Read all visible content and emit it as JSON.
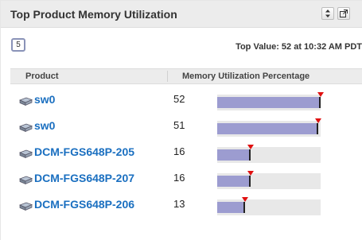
{
  "widget": {
    "title": "Top Product Memory Utilization",
    "count": "5",
    "top_value": "Top Value: 52 at 10:32 AM PDT"
  },
  "columns": {
    "product": "Product",
    "memory": "Memory Utilization Percentage"
  },
  "rows": [
    {
      "name": "sw0",
      "value": "52",
      "fraction": 0.985
    },
    {
      "name": "sw0",
      "value": "51",
      "fraction": 0.965
    },
    {
      "name": "DCM-FGS648P-205",
      "value": "16",
      "fraction": 0.31
    },
    {
      "name": "DCM-FGS648P-207",
      "value": "16",
      "fraction": 0.31
    },
    {
      "name": "DCM-FGS648P-206",
      "value": "13",
      "fraction": 0.25
    }
  ],
  "colors": {
    "bar": "#9c9cd0",
    "marker": "#e01010",
    "link": "#1a6fc0"
  },
  "icons": {
    "sort": "sort-arrows-icon",
    "popout": "popout-icon",
    "device": "network-switch-icon"
  }
}
